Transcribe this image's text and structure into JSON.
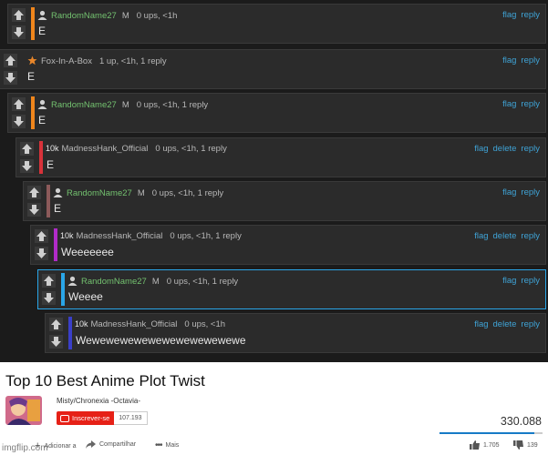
{
  "comments": [
    {
      "user": "RandomName27",
      "badge": "",
      "icon": "user-icon",
      "mod": "M",
      "meta": "0 ups, <1h",
      "body": "E",
      "actions": [
        "flag",
        "reply"
      ],
      "color": "#f0861c"
    },
    {
      "user": "Fox-In-A-Box",
      "badge": "",
      "icon": "star-icon",
      "mod": "",
      "meta": "1 up, <1h, 1 reply",
      "body": "E",
      "actions": [
        "flag",
        "reply"
      ],
      "color": ""
    },
    {
      "user": "RandomName27",
      "badge": "",
      "icon": "user-icon",
      "mod": "M",
      "meta": "0 ups, <1h, 1 reply",
      "body": "E",
      "actions": [
        "flag",
        "reply"
      ],
      "color": "#f0861c"
    },
    {
      "user": "MadnessHank_Official",
      "badge": "10k",
      "icon": "",
      "mod": "",
      "meta": "0 ups, <1h, 1 reply",
      "body": "E",
      "actions": [
        "flag",
        "delete",
        "reply"
      ],
      "color": "#d8323a"
    },
    {
      "user": "RandomName27",
      "badge": "",
      "icon": "user-icon",
      "mod": "M",
      "meta": "0 ups, <1h, 1 reply",
      "body": "E",
      "actions": [
        "flag",
        "reply"
      ],
      "color": "#8c5a5a"
    },
    {
      "user": "MadnessHank_Official",
      "badge": "10k",
      "icon": "",
      "mod": "",
      "meta": "0 ups, <1h, 1 reply",
      "body": "Weeeeeee",
      "actions": [
        "flag",
        "delete",
        "reply"
      ],
      "color": "#b02bc8"
    },
    {
      "user": "RandomName27",
      "badge": "",
      "icon": "user-icon",
      "mod": "M",
      "meta": "0 ups, <1h, 1 reply",
      "body": "Weeee",
      "actions": [
        "flag",
        "reply"
      ],
      "color": "#2aa6e8"
    },
    {
      "user": "MadnessHank_Official",
      "badge": "10k",
      "icon": "",
      "mod": "",
      "meta": "0 ups, <1h",
      "body": "Wewewewewewewewewewewewe",
      "actions": [
        "flag",
        "delete",
        "reply"
      ],
      "color": "#3a3fc8"
    }
  ],
  "video": {
    "title": "Top 10 Best Anime Plot Twist",
    "channel": "Misty/Chronexia -Octavia-",
    "subscribe_label": "Inscrever-se",
    "subscriber_count": "107.193",
    "views": "330.088",
    "like_ratio": 0.92,
    "add_label": "Adicionar a",
    "share_label": "Compartilhar",
    "more_label": "Mais",
    "likes": "1.705",
    "dislikes": "139"
  },
  "watermark": "imgflip.com",
  "colors": {
    "link": "#3fa3d6",
    "username": "#73c16f",
    "youtube_red": "#e62117"
  }
}
